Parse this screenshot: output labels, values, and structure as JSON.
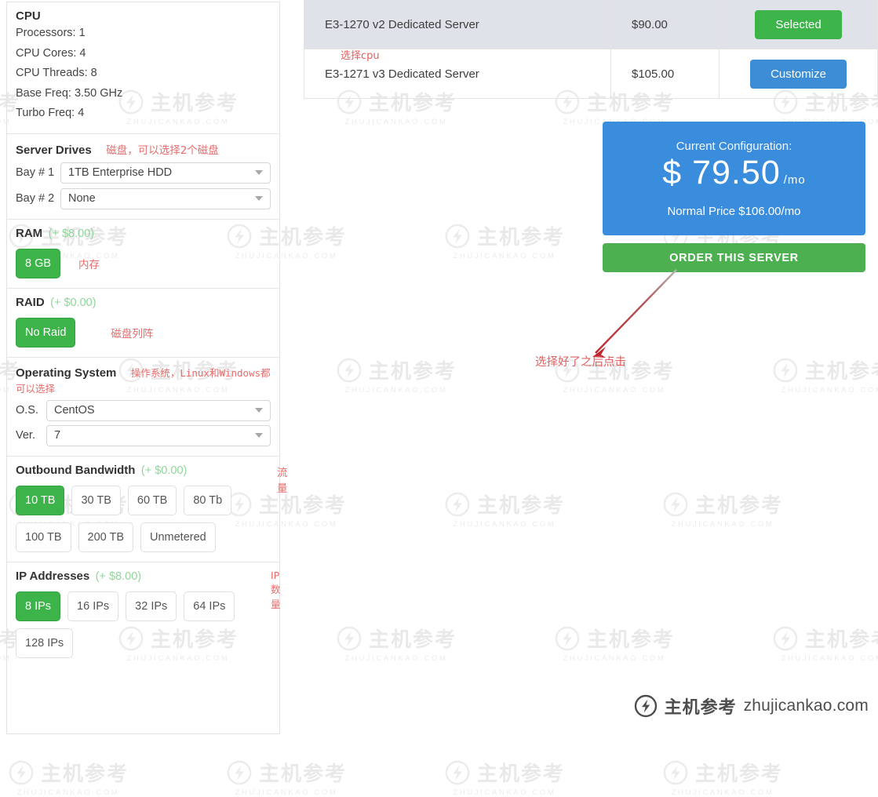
{
  "servers": {
    "rows": [
      {
        "name": "E3-1270 v2 Dedicated Server",
        "price": "$90.00",
        "action": "Selected",
        "state": "selected"
      },
      {
        "name": "E3-1271 v3 Dedicated Server",
        "price": "$105.00",
        "action": "Customize",
        "state": "default"
      }
    ],
    "note_cpu": "选择cpu"
  },
  "config": {
    "title": "Current Configuration:",
    "currency": "$",
    "amount": "79.50",
    "per": "/mo",
    "normal_price": "Normal Price $106.00/mo",
    "order_button": "ORDER THIS SERVER",
    "note_order": "选择好了之后点击"
  },
  "cpu": {
    "title": "CPU",
    "specs": [
      "Processors: 1",
      "CPU Cores: 4",
      "CPU Threads: 8",
      "Base Freq: 3.50 GHz",
      "Turbo Freq: 4"
    ]
  },
  "drives": {
    "title": "Server Drives",
    "note": "磁盘，可以选择2个磁盘",
    "bays": [
      {
        "label": "Bay # 1",
        "value": "1TB Enterprise HDD"
      },
      {
        "label": "Bay # 2",
        "value": "None"
      }
    ]
  },
  "ram": {
    "title": "RAM",
    "price": "(+ $8.00)",
    "note": "内存",
    "options": [
      {
        "label": "8 GB",
        "selected": true
      }
    ]
  },
  "raid": {
    "title": "RAID",
    "price": "(+ $0.00)",
    "note": "磁盘列阵",
    "options": [
      {
        "label": "No Raid",
        "selected": true
      }
    ]
  },
  "os": {
    "title": "Operating System",
    "note": "操作系统，Linux和Windows都可以选择",
    "fields": [
      {
        "label": "O.S.",
        "value": "CentOS"
      },
      {
        "label": "Ver.",
        "value": "7"
      }
    ]
  },
  "bandwidth": {
    "title": "Outbound Bandwidth",
    "price": "(+ $0.00)",
    "note": "流量",
    "options": [
      {
        "label": "10 TB",
        "selected": true
      },
      {
        "label": "30 TB",
        "selected": false
      },
      {
        "label": "60 TB",
        "selected": false
      },
      {
        "label": "80 Tb",
        "selected": false
      },
      {
        "label": "100 TB",
        "selected": false
      },
      {
        "label": "200 TB",
        "selected": false
      },
      {
        "label": "Unmetered",
        "selected": false
      }
    ]
  },
  "ips": {
    "title": "IP Addresses",
    "price": "(+ $8.00)",
    "note": "IP数量",
    "options": [
      {
        "label": "8 IPs",
        "selected": true
      },
      {
        "label": "16 IPs",
        "selected": false
      },
      {
        "label": "32 IPs",
        "selected": false
      },
      {
        "label": "64 IPs",
        "selected": false
      },
      {
        "label": "128 IPs",
        "selected": false
      }
    ]
  },
  "brand": {
    "cn": "主机参考",
    "en": "zhujicankao.com",
    "icon": "lightning-circle-icon"
  },
  "watermark": {
    "cn": "主机参考",
    "en": "ZHUJICANKAO.COM"
  },
  "colors": {
    "green": "#3cb44a",
    "blue": "#3c8dd5",
    "config_blue": "#3a8cdc",
    "order_green": "#4cb050",
    "selected_row": "#dfe2e8",
    "note_red": "#e06060",
    "price_green": "#8fd79b"
  }
}
